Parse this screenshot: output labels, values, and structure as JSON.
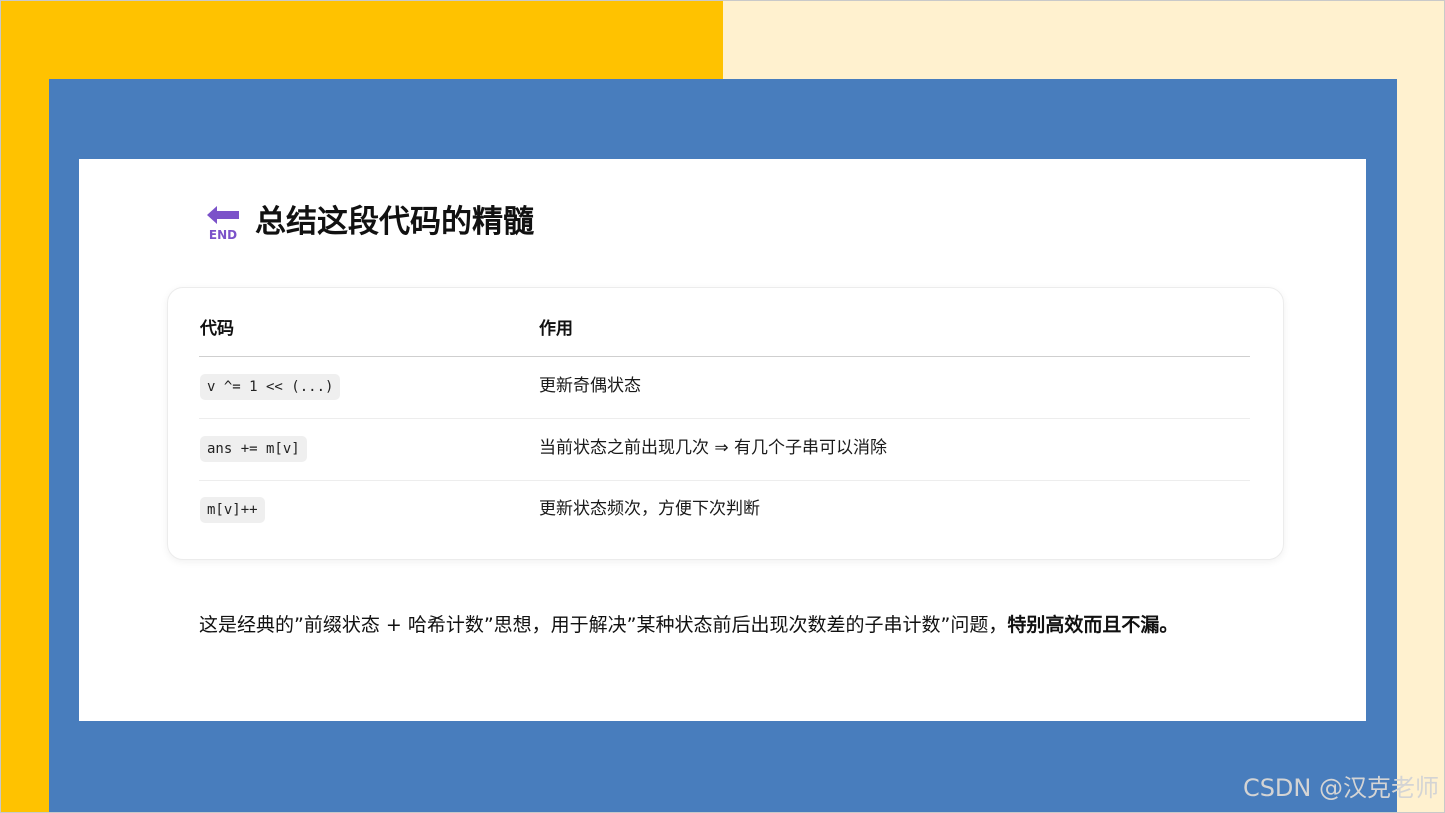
{
  "title": "总结这段代码的精髓",
  "icon": {
    "name": "end-arrow-icon",
    "text": "END",
    "color": "#7b52c9"
  },
  "table": {
    "headers": [
      "代码",
      "作用"
    ],
    "rows": [
      {
        "code": "v ^= 1 << (...)",
        "effect": "更新奇偶状态"
      },
      {
        "code": "ans += m[v]",
        "effect": "当前状态之前出现几次 ⇒ 有几个子串可以消除"
      },
      {
        "code": "m[v]++",
        "effect": "更新状态频次，方便下次判断"
      }
    ]
  },
  "summary": {
    "normal": "这是经典的”前缀状态 + 哈希计数”思想，用于解决”某种状态前后出现次数差的子串计数”问题，",
    "bold": "特别高效而且不漏。"
  },
  "watermark": "CSDN @汉克老师",
  "colors": {
    "yellow": "#ffc200",
    "cream": "#fff1cf",
    "blue": "#487dbd",
    "accent": "#7b52c9"
  }
}
